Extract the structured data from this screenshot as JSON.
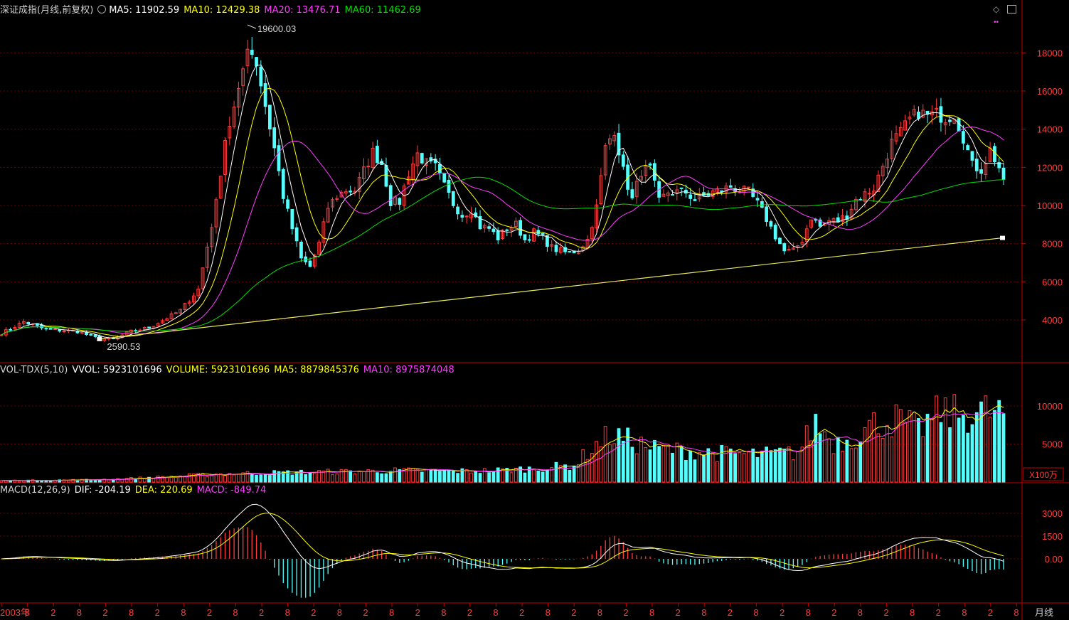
{
  "header": {
    "title": "深证成指(月线,前复权)",
    "ma5": "MA5: 11902.59",
    "ma10": "MA10: 12429.38",
    "ma20": "MA20: 13476.71",
    "ma60": "MA60: 11462.69"
  },
  "vol_header": {
    "name": "VOL-TDX(5,10)",
    "vvol": "VVOL: 5923101696",
    "volume": "VOLUME: 5923101696",
    "ma5": "MA5: 8879845376",
    "ma10": "MA10: 8975874048"
  },
  "macd_header": {
    "name": "MACD(12,26,9)",
    "dif": "DIF: -204.19",
    "dea": "DEA: 220.69",
    "macd": "MACD: -849.74"
  },
  "vol_unit": "X100万",
  "period_label": "月线",
  "colors": {
    "up": "#ff3d3d",
    "down": "#54ffff",
    "ma5": "#ffffff",
    "ma10": "#ffff00",
    "ma20": "#ff3dff",
    "ma60": "#00e000",
    "grid": "#6b0000",
    "axis": "#c00000",
    "trend": "#e8e85a"
  },
  "chart_data": [
    {
      "type": "candlestick",
      "title": "深证成指(月线,前复权)",
      "ylim": [
        2000,
        20000
      ],
      "y_ticks": [
        4000,
        6000,
        8000,
        10000,
        12000,
        14000,
        16000,
        18000
      ],
      "x_labels": [
        "2003年",
        "8",
        "2",
        "8",
        "2",
        "8",
        "2",
        "8",
        "2",
        "8",
        "2",
        "8",
        "2",
        "8",
        "2",
        "8",
        "2",
        "8",
        "2",
        "8",
        "2",
        "8",
        "2",
        "8",
        "2",
        "8",
        "2",
        "8",
        "2",
        "8",
        "2",
        "8",
        "2",
        "8",
        "2",
        "8",
        "2",
        "8",
        "2",
        "8"
      ],
      "annotations": {
        "high": "19600.03",
        "low": "2590.53"
      },
      "close_anchors": [
        [
          0,
          3300
        ],
        [
          5,
          3900
        ],
        [
          10,
          3500
        ],
        [
          17,
          3400
        ],
        [
          22,
          3000
        ],
        [
          25,
          3000
        ],
        [
          29,
          3400
        ],
        [
          33,
          3600
        ],
        [
          37,
          4100
        ],
        [
          40,
          4500
        ],
        [
          44,
          5600
        ],
        [
          48,
          10100
        ],
        [
          50,
          13500
        ],
        [
          53,
          15800
        ],
        [
          55,
          18500
        ],
        [
          57,
          17500
        ],
        [
          61,
          13000
        ],
        [
          63,
          10500
        ],
        [
          65,
          8800
        ],
        [
          67,
          7200
        ],
        [
          69,
          6800
        ],
        [
          71,
          8000
        ],
        [
          73,
          9900
        ],
        [
          75,
          10500
        ],
        [
          77,
          10800
        ],
        [
          79,
          10800
        ],
        [
          81,
          11800
        ],
        [
          83,
          12800
        ],
        [
          85,
          12200
        ],
        [
          87,
          10200
        ],
        [
          89,
          10200
        ],
        [
          91,
          11700
        ],
        [
          93,
          12700
        ],
        [
          95,
          12200
        ],
        [
          97,
          12000
        ],
        [
          99,
          11000
        ],
        [
          101,
          10100
        ],
        [
          103,
          9500
        ],
        [
          105,
          9800
        ],
        [
          107,
          8900
        ],
        [
          109,
          8800
        ],
        [
          111,
          8300
        ],
        [
          113,
          8800
        ],
        [
          115,
          9000
        ],
        [
          117,
          8200
        ],
        [
          119,
          8600
        ],
        [
          121,
          8300
        ],
        [
          123,
          7800
        ],
        [
          125,
          7600
        ],
        [
          127,
          7500
        ],
        [
          129,
          7700
        ],
        [
          131,
          8200
        ],
        [
          133,
          9900
        ],
        [
          135,
          13000
        ],
        [
          137,
          14000
        ],
        [
          139,
          11800
        ],
        [
          141,
          10300
        ],
        [
          143,
          11800
        ],
        [
          145,
          11900
        ],
        [
          147,
          10200
        ],
        [
          149,
          10700
        ],
        [
          151,
          10700
        ],
        [
          153,
          10700
        ],
        [
          155,
          10300
        ],
        [
          157,
          10500
        ],
        [
          159,
          10700
        ],
        [
          161,
          10800
        ],
        [
          163,
          11000
        ],
        [
          165,
          10800
        ],
        [
          167,
          10700
        ],
        [
          169,
          10100
        ],
        [
          171,
          9300
        ],
        [
          173,
          8400
        ],
        [
          175,
          7600
        ],
        [
          177,
          7600
        ],
        [
          179,
          8200
        ],
        [
          181,
          9400
        ],
        [
          183,
          8900
        ],
        [
          185,
          9200
        ],
        [
          187,
          9200
        ],
        [
          189,
          9500
        ],
        [
          191,
          10300
        ],
        [
          193,
          10600
        ],
        [
          195,
          10900
        ],
        [
          197,
          12100
        ],
        [
          199,
          13300
        ],
        [
          201,
          13800
        ],
        [
          203,
          14500
        ],
        [
          205,
          14900
        ],
        [
          207,
          14700
        ],
        [
          209,
          14800
        ],
        [
          211,
          14600
        ],
        [
          213,
          14800
        ],
        [
          215,
          13600
        ],
        [
          217,
          12100
        ],
        [
          219,
          11900
        ],
        [
          221,
          12900
        ],
        [
          223,
          12000
        ],
        [
          224,
          11100
        ]
      ],
      "series": [
        {
          "name": "MA5",
          "value": 11902.59
        },
        {
          "name": "MA10",
          "value": 12429.38
        },
        {
          "name": "MA20",
          "value": 13476.71
        },
        {
          "name": "MA60",
          "value": 11462.69
        }
      ]
    },
    {
      "type": "bar",
      "title": "VOL-TDX(5,10)",
      "ylim": [
        0,
        13000
      ],
      "y_ticks": [
        5000,
        10000
      ],
      "unit": "X100万",
      "vol_anchors": [
        [
          0,
          200
        ],
        [
          20,
          300
        ],
        [
          30,
          500
        ],
        [
          40,
          800
        ],
        [
          50,
          1100
        ],
        [
          60,
          1200
        ],
        [
          70,
          1300
        ],
        [
          80,
          1400
        ],
        [
          90,
          1500
        ],
        [
          100,
          1400
        ],
        [
          110,
          1500
        ],
        [
          120,
          1800
        ],
        [
          128,
          2200
        ],
        [
          132,
          4500
        ],
        [
          136,
          6200
        ],
        [
          140,
          5500
        ],
        [
          146,
          4400
        ],
        [
          150,
          4200
        ],
        [
          160,
          3800
        ],
        [
          170,
          3600
        ],
        [
          178,
          3900
        ],
        [
          182,
          7800
        ],
        [
          186,
          5200
        ],
        [
          190,
          5800
        ],
        [
          195,
          7600
        ],
        [
          200,
          8200
        ],
        [
          205,
          6900
        ],
        [
          210,
          9200
        ],
        [
          215,
          8800
        ],
        [
          220,
          9300
        ],
        [
          224,
          9000
        ]
      ],
      "series": [
        {
          "name": "VOLUME",
          "value": 5923101696
        },
        {
          "name": "MA5",
          "value": 8879845376
        },
        {
          "name": "MA10",
          "value": 8975874048
        }
      ]
    },
    {
      "type": "bar",
      "title": "MACD(12,26,9)",
      "ylim": [
        -3500,
        4500
      ],
      "y_ticks": [
        0.0,
        1500,
        3000
      ],
      "y_tick_labels": [
        "0.00",
        "1500",
        "3000"
      ],
      "series": [
        {
          "name": "DIF",
          "value": -204.19
        },
        {
          "name": "DEA",
          "value": 220.69
        },
        {
          "name": "MACD",
          "value": -849.74
        }
      ]
    }
  ]
}
